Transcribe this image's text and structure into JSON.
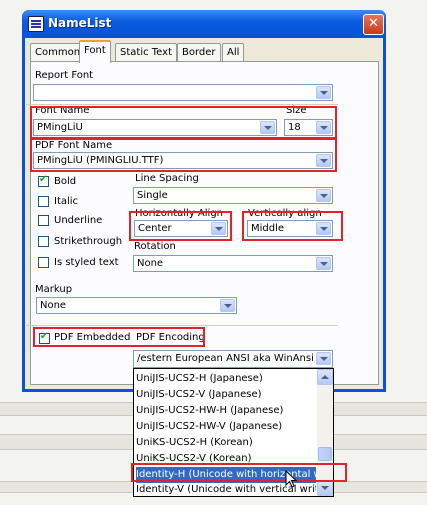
{
  "window": {
    "title": "NameList",
    "close_glyph": "✕"
  },
  "tabs": [
    {
      "label": "Common",
      "active": false
    },
    {
      "label": "Font",
      "active": true
    },
    {
      "label": "Static Text",
      "active": false
    },
    {
      "label": "Border",
      "active": false
    },
    {
      "label": "All",
      "active": false
    }
  ],
  "report_font": {
    "label": "Report Font",
    "value": ""
  },
  "font_name": {
    "label": "Font Name",
    "value": "PMingLiU"
  },
  "size": {
    "label": "Size",
    "value": "18"
  },
  "pdf_font_name": {
    "label": "PDF Font Name",
    "value": "PMingLiU (PMINGLIU.TTF)"
  },
  "style_checks": [
    {
      "label": "Bold",
      "checked": true
    },
    {
      "label": "Italic",
      "checked": false
    },
    {
      "label": "Underline",
      "checked": false
    },
    {
      "label": "Strikethrough",
      "checked": false
    },
    {
      "label": "Is styled text",
      "checked": false
    }
  ],
  "line_spacing": {
    "label": "Line Spacing",
    "value": "Single"
  },
  "h_align": {
    "label": "Horizontally Align",
    "value": "Center"
  },
  "v_align": {
    "label": "Vertically align",
    "value": "Middle"
  },
  "rotation": {
    "label": "Rotation",
    "value": "None"
  },
  "markup": {
    "label": "Markup",
    "value": "None"
  },
  "pdf_embedded": {
    "label": "PDF Embedded",
    "checked": true
  },
  "pdf_encoding": {
    "label": "PDF Encoding",
    "value": "/estern European ANSI aka WinAnsi)"
  },
  "encoding_options": [
    "UniJIS-UCS2-H (Japanese)",
    "UniJIS-UCS2-V (Japanese)",
    "UniJIS-UCS2-HW-H (Japanese)",
    "UniJIS-UCS2-HW-V (Japanese)",
    "UniKS-UCS2-H (Korean)",
    "UniKS-UCS2-V (Korean)",
    "Identity-H (Unicode with horizontal wr",
    "Identity-V (Unicode with vertical writir"
  ],
  "highlighted_option_index": 6,
  "icons": {
    "title": "window-icon",
    "dropdown": "chevron-down-icon",
    "cursor": "mouse-pointer-icon"
  },
  "colors": {
    "titlebar": "#0a5ce0",
    "highlight": "#316ac5",
    "annotation": "#e0242a"
  }
}
